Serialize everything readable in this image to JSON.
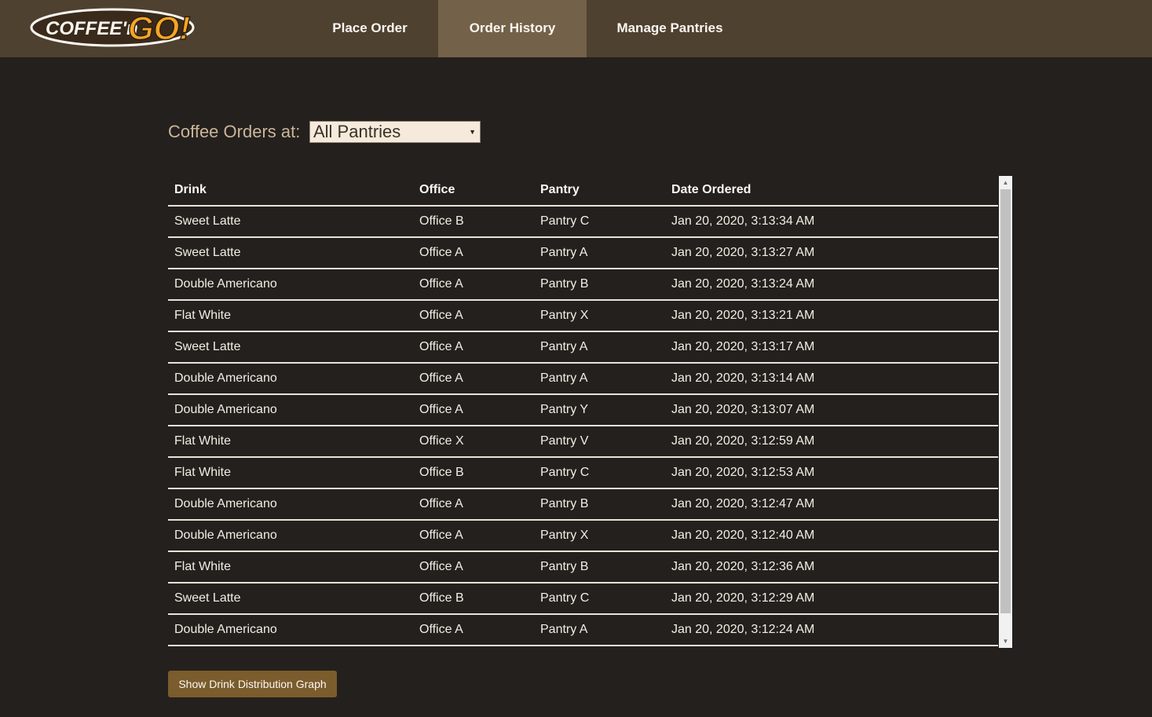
{
  "logo": {
    "text_coffee": "COFFEE'n",
    "text_go": "GO!"
  },
  "nav": {
    "items": [
      {
        "label": "Place Order",
        "active": false
      },
      {
        "label": "Order History",
        "active": true
      },
      {
        "label": "Manage Pantries",
        "active": false
      }
    ]
  },
  "filter": {
    "label": "Coffee Orders at:",
    "selected": "All Pantries"
  },
  "table": {
    "columns": [
      "Drink",
      "Office",
      "Pantry",
      "Date Ordered"
    ],
    "rows": [
      [
        "Sweet Latte",
        "Office B",
        "Pantry C",
        "Jan 20, 2020, 3:13:34 AM"
      ],
      [
        "Sweet Latte",
        "Office A",
        "Pantry A",
        "Jan 20, 2020, 3:13:27 AM"
      ],
      [
        "Double Americano",
        "Office A",
        "Pantry B",
        "Jan 20, 2020, 3:13:24 AM"
      ],
      [
        "Flat White",
        "Office A",
        "Pantry X",
        "Jan 20, 2020, 3:13:21 AM"
      ],
      [
        "Sweet Latte",
        "Office A",
        "Pantry A",
        "Jan 20, 2020, 3:13:17 AM"
      ],
      [
        "Double Americano",
        "Office A",
        "Pantry A",
        "Jan 20, 2020, 3:13:14 AM"
      ],
      [
        "Double Americano",
        "Office A",
        "Pantry Y",
        "Jan 20, 2020, 3:13:07 AM"
      ],
      [
        "Flat White",
        "Office X",
        "Pantry V",
        "Jan 20, 2020, 3:12:59 AM"
      ],
      [
        "Flat White",
        "Office B",
        "Pantry C",
        "Jan 20, 2020, 3:12:53 AM"
      ],
      [
        "Double Americano",
        "Office A",
        "Pantry B",
        "Jan 20, 2020, 3:12:47 AM"
      ],
      [
        "Double Americano",
        "Office A",
        "Pantry X",
        "Jan 20, 2020, 3:12:40 AM"
      ],
      [
        "Flat White",
        "Office A",
        "Pantry B",
        "Jan 20, 2020, 3:12:36 AM"
      ],
      [
        "Sweet Latte",
        "Office B",
        "Pantry C",
        "Jan 20, 2020, 3:12:29 AM"
      ],
      [
        "Double Americano",
        "Office A",
        "Pantry A",
        "Jan 20, 2020, 3:12:24 AM"
      ]
    ]
  },
  "actions": {
    "graph_button": "Show Drink Distribution Graph"
  },
  "colors": {
    "background": "#24201d",
    "topbar": "#4e412f",
    "active_tab": "#736249",
    "label": "#cbb59a",
    "button": "#7a5c2d"
  },
  "icons": {
    "dropdown": "caret-down-icon",
    "scroll_up": "arrow-up-icon",
    "scroll_down": "arrow-down-icon"
  }
}
